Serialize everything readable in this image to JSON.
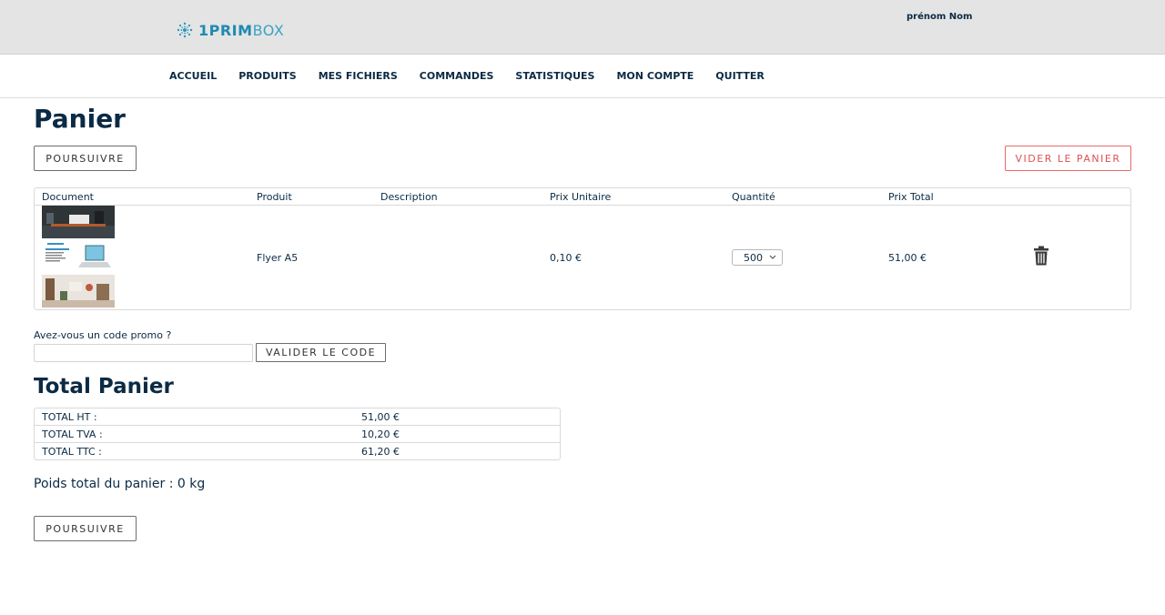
{
  "header": {
    "logo_bold": "1PRIM",
    "logo_light": "BOX",
    "user_name": "prénom Nom"
  },
  "nav": {
    "items": [
      "ACCUEIL",
      "PRODUITS",
      "MES FICHIERS",
      "COMMANDES",
      "STATISTIQUES",
      "MON COMPTE",
      "QUITTER"
    ]
  },
  "page": {
    "title": "Panier",
    "continue_label": "POURSUIVRE",
    "empty_cart_label": "VIDER LE PANIER"
  },
  "cart": {
    "columns": [
      "Document",
      "Produit",
      "Description",
      "Prix Unitaire",
      "Quantité",
      "Prix Total"
    ],
    "rows": [
      {
        "product": "Flyer A5",
        "description": "",
        "unit_price": "0,10 €",
        "quantity": "500",
        "total_price": "51,00 €"
      }
    ]
  },
  "promo": {
    "label": "Avez-vous un code promo ?",
    "input_value": "",
    "validate_label": "VALIDER LE CODE"
  },
  "totals": {
    "title": "Total Panier",
    "rows": [
      {
        "label": "TOTAL HT :",
        "value": "51,00 €"
      },
      {
        "label": "TOTAL TVA :",
        "value": "10,20 €"
      },
      {
        "label": "TOTAL TTC :",
        "value": "61,20 €"
      }
    ]
  },
  "weight": {
    "text": "Poids total du panier : 0 kg"
  },
  "footer": {
    "continue_label": "POURSUIVRE"
  },
  "colors": {
    "brand": "#1f8bb0",
    "text": "#0b2a44",
    "danger": "#e05050"
  }
}
